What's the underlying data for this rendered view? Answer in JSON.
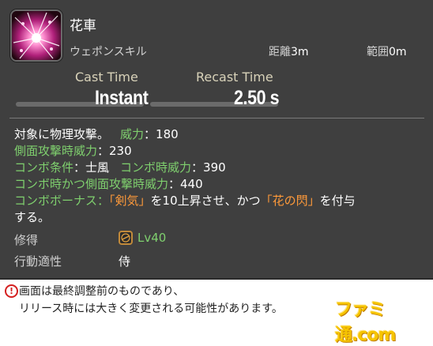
{
  "skill": {
    "name": "花車",
    "category": "ウェポンスキル",
    "range_label": "距離",
    "range_value": "3m",
    "radius_label": "範囲",
    "radius_value": "0m",
    "cast_time_label": "Cast Time",
    "cast_time_value": "Instant",
    "recast_time_label": "Recast Time",
    "recast_time_value": "2.50 s"
  },
  "description": {
    "line1_a": "対象に物理攻撃。",
    "line1_b": "威力",
    "line1_c": "：180",
    "line2_a": "側面攻撃時威力",
    "line2_b": "：230",
    "line3_a": "コンボ条件",
    "line3_b": "：士風",
    "line3_c": "コンボ時威力",
    "line3_d": "：390",
    "line4_a": "コンボ時かつ側面攻撃時威力",
    "line4_b": "：440",
    "line5_a": "コンボボーナス",
    "line5_b": "：",
    "line5_c": "「剣気」",
    "line5_d": "を10上昇させ、かつ",
    "line5_e": "「花の閃」",
    "line5_f": "を付与",
    "line6": "する。"
  },
  "acquire": {
    "label": "修得",
    "level": "Lv40",
    "icon": "samurai-job-icon"
  },
  "jobs": {
    "label": "行動適性",
    "value": "侍"
  },
  "notice": {
    "icon": "exclamation-icon",
    "line1": "画面は最終調整前のものであり、",
    "line2": "リリース時には大きく変更される可能性があります。"
  },
  "watermark": {
    "text": "ファミ通.com"
  },
  "colors": {
    "panel": "#3f3f3f",
    "green": "#7fd06e",
    "orange": "#ff9a3a",
    "label_gold": "#d8d2b9",
    "notice_red": "#d42020"
  }
}
